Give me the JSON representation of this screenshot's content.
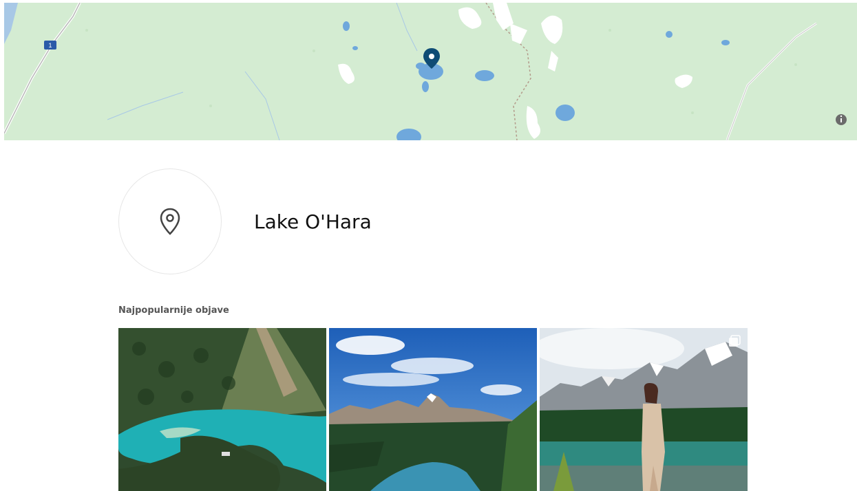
{
  "map": {
    "road_shield": "1",
    "colors": {
      "land": "#d4ecd2",
      "water": "#6fa8dc",
      "marker": "#0f4c75",
      "snow": "#ffffff",
      "road": "#b9b9b9"
    },
    "marker_icon": "map-pin-icon",
    "info_icon": "info-icon"
  },
  "location": {
    "name": "Lake O'Hara",
    "avatar_icon": "location-pin-outline-icon"
  },
  "top_posts": {
    "label": "Najpopularnije objave",
    "posts": [
      {
        "subject": "aerial turquoise lake"
      },
      {
        "subject": "mountain peak and lake"
      },
      {
        "subject": "woman at alpine lake",
        "multi_icon": "multiple-photos-icon"
      }
    ]
  }
}
